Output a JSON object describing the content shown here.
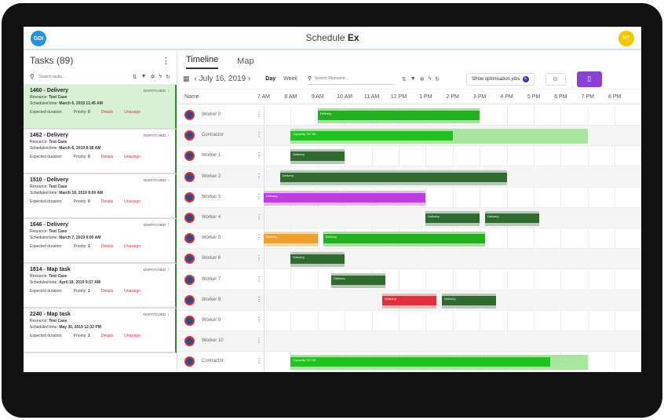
{
  "app": {
    "title_prefix": "Schedule",
    "title_suffix": "Ex",
    "logo": "GDI",
    "avatar": "MT"
  },
  "tasks_panel": {
    "title": "Tasks (89)",
    "menu_icon": "more-vert-icon",
    "search_placeholder": "Search tasks...",
    "tasks": [
      {
        "title": "1460 - Delivery",
        "status": "DISPATCHED",
        "resource_label": "Resource:",
        "resource": "Test Case",
        "time_label": "Scheduled time:",
        "time": "March 6, 2019 11:45 AM",
        "duration_label": "Expected duration:",
        "priority_label": "Priority:",
        "priority": "0",
        "details": "Details",
        "unassign": "Unassign",
        "selected": true
      },
      {
        "title": "1462 - Delivery",
        "status": "DISPATCHED",
        "resource_label": "Resource:",
        "resource": "Test Case",
        "time_label": "Scheduled time:",
        "time": "March 6, 2019 8:38 AM",
        "duration_label": "Expected duration:",
        "priority_label": "Priority:",
        "priority": "0",
        "details": "Details",
        "unassign": "Unassign",
        "selected": false
      },
      {
        "title": "1510 - Delivery",
        "status": "DISPATCHED",
        "resource_label": "Resource:",
        "resource": "Test Case",
        "time_label": "Scheduled time:",
        "time": "March 18, 2019 8:00 AM",
        "duration_label": "Expected duration:",
        "priority_label": "Priority:",
        "priority": "0",
        "details": "Details",
        "unassign": "Unassign",
        "selected": false
      },
      {
        "title": "1646 - Delivery",
        "status": "DISPATCHED",
        "resource_label": "Resource:",
        "resource": "Test Case",
        "time_label": "Scheduled time:",
        "time": "March 7, 2019 9:00 AM",
        "duration_label": "Expected duration:",
        "priority_label": "Priority:",
        "priority": "1",
        "details": "Details",
        "unassign": "Unassign",
        "selected": false
      },
      {
        "title": "1814 - Map task",
        "status": "DISPATCHED",
        "resource_label": "Resource:",
        "resource": "Test Case",
        "time_label": "Scheduled time:",
        "time": "April 18, 2019 9:57 AM",
        "duration_label": "Expected duration:",
        "priority_label": "Priority:",
        "priority": "1",
        "details": "Details",
        "unassign": "Unassign",
        "selected": false
      },
      {
        "title": "2240 - Map task",
        "status": "DISPATCHED",
        "resource_label": "Resource:",
        "resource": "Test Case",
        "time_label": "Scheduled time:",
        "time": "May 30, 2019 12:32 PM",
        "duration_label": "Expected duration:",
        "priority_label": "Priority:",
        "priority": "1",
        "details": "Details",
        "unassign": "Unassign",
        "selected": false
      }
    ]
  },
  "schedule": {
    "tabs": [
      "Timeline",
      "Map"
    ],
    "date": "July 16, 2019",
    "day_label": "Day",
    "week_label": "Week",
    "search_placeholder": "Search Resource...",
    "optimisation_button": "Show optimisation jobs",
    "name_header": "Name",
    "hours": [
      "7 AM",
      "8 AM",
      "9 AM",
      "10 AM",
      "11 AM",
      "12 PM",
      "1 PM",
      "2 PM",
      "3 PM",
      "4 PM",
      "5 PM",
      "6 PM",
      "7 PM",
      "8 PM"
    ],
    "resources": [
      {
        "name": "Worker 0",
        "jobs": [
          {
            "label": "Delivery",
            "start": 9.0,
            "end": 15.0,
            "color": "#22b022",
            "bg": "#a8dfa0"
          }
        ]
      },
      {
        "name": "Contractor",
        "jobs": [
          {
            "label": "Capacity 767.00",
            "start": 8.0,
            "end": 14.0,
            "color": "#1ec41e",
            "bg": "#a8e6a0",
            "bg_end": 19.0
          }
        ]
      },
      {
        "name": "Worker 1",
        "jobs": [
          {
            "label": "Delivery",
            "start": 8.0,
            "end": 10.0,
            "color": "#2f6b2f",
            "bg": "#b8c8b8"
          }
        ]
      },
      {
        "name": "Worker 2",
        "jobs": [
          {
            "label": "Delivery",
            "start": 7.6,
            "end": 16.0,
            "color": "#2f6b2f",
            "bg": "#b8c8b8"
          }
        ]
      },
      {
        "name": "Worker 3",
        "jobs": [
          {
            "label": "Delivery",
            "start": 7.0,
            "end": 13.0,
            "color": "#c03ee0",
            "bg": "#e5b8f0"
          }
        ]
      },
      {
        "name": "Worker 4",
        "jobs": [
          {
            "label": "Delivery",
            "start": 13.0,
            "end": 15.0,
            "color": "#2f6b2f",
            "bg": "#b8c8b8"
          },
          {
            "label": "Delivery",
            "start": 15.2,
            "end": 17.2,
            "color": "#2f6b2f",
            "bg": "#b8c8b8"
          }
        ]
      },
      {
        "name": "Worker 5",
        "jobs": [
          {
            "label": "Delivery",
            "start": 7.0,
            "end": 9.0,
            "color": "#f0a030",
            "bg": "#f8d8a8"
          },
          {
            "label": "Delivery",
            "start": 9.2,
            "end": 15.2,
            "color": "#22b022",
            "bg": "#a8dfa0"
          }
        ]
      },
      {
        "name": "Worker 6",
        "jobs": [
          {
            "label": "Delivery",
            "start": 8.0,
            "end": 10.0,
            "color": "#2f6b2f",
            "bg": "#b8c8b8"
          }
        ]
      },
      {
        "name": "Worker 7",
        "jobs": [
          {
            "label": "Delivery",
            "start": 9.5,
            "end": 11.5,
            "color": "#2f6b2f",
            "bg": "#b8c8b8"
          }
        ]
      },
      {
        "name": "Worker 8",
        "jobs": [
          {
            "label": "Delivery",
            "start": 11.4,
            "end": 13.4,
            "color": "#e03040",
            "bg": "#f0b8b8"
          },
          {
            "label": "Delivery",
            "start": 13.6,
            "end": 15.6,
            "color": "#2f6b2f",
            "bg": "#b8c8b8"
          }
        ]
      },
      {
        "name": "Worker 9",
        "jobs": []
      },
      {
        "name": "Worker 10",
        "jobs": []
      },
      {
        "name": "Contractor",
        "jobs": [
          {
            "label": "Capacity 767.00",
            "start": 8.0,
            "end": 17.6,
            "color": "#1ec41e",
            "bg": "#a8e6a0",
            "bg_end": 19.0
          }
        ]
      }
    ]
  }
}
